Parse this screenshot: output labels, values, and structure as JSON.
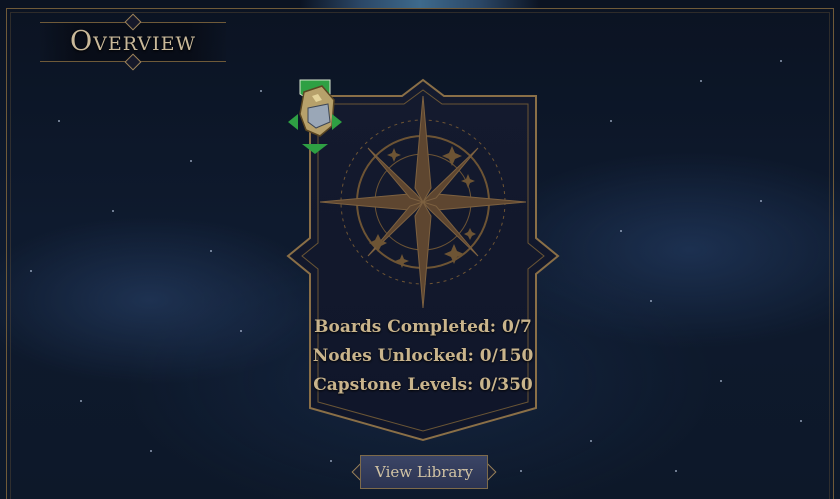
{
  "header": {
    "title": "Overview"
  },
  "card": {
    "icon": "gauntlet-class-icon",
    "stats": [
      {
        "label": "Boards Completed: 0/7"
      },
      {
        "label": "Nodes Unlocked: 0/150"
      },
      {
        "label": "Capstone Levels: 0/350"
      }
    ]
  },
  "actions": {
    "view_library": "View Library"
  },
  "colors": {
    "gold": "#a1865a",
    "text": "#c9b48c",
    "background": "#0e1a2e",
    "marker_green": "#2ea043"
  }
}
